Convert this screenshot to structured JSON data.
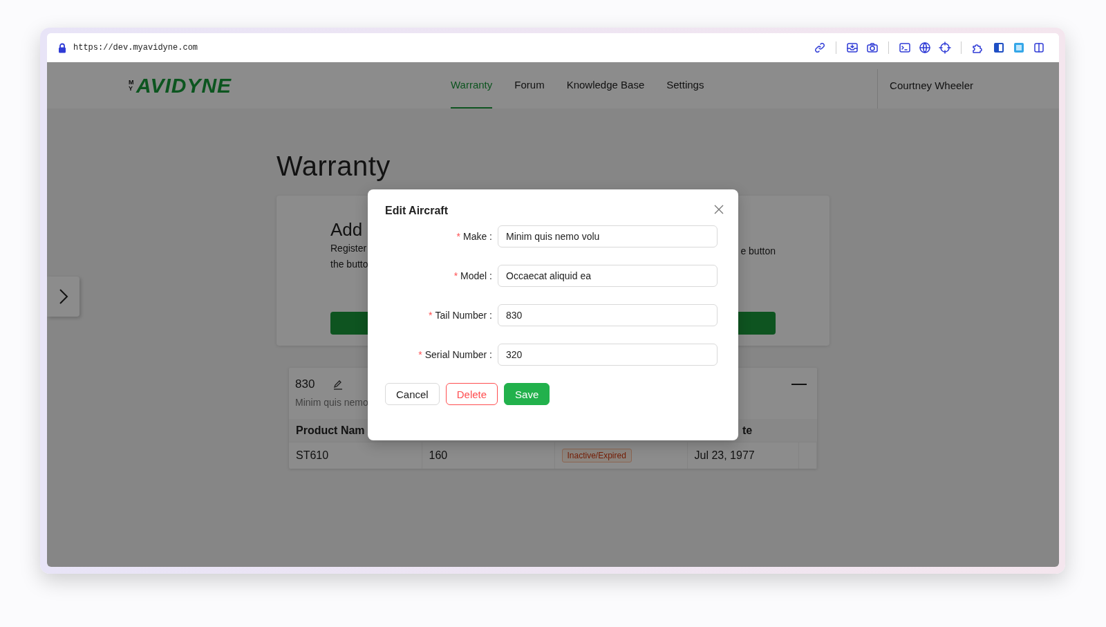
{
  "browser": {
    "url": "https://dev.myavidyne.com"
  },
  "header": {
    "logo": {
      "prefix": "MY",
      "name": "AVIDYNE"
    },
    "nav": [
      {
        "label": "Warranty",
        "selected": true
      },
      {
        "label": "Forum",
        "selected": false
      },
      {
        "label": "Knowledge Base",
        "selected": false
      },
      {
        "label": "Settings",
        "selected": false
      }
    ],
    "user": "Courtney Wheeler"
  },
  "page": {
    "title": "Warranty",
    "add_card": {
      "title": "Add",
      "left_lines": [
        "Register",
        "the butto"
      ],
      "right_text": "e button"
    },
    "aircraft": {
      "tail_number": "830",
      "subtitle": "Minim quis nemo",
      "table": {
        "column_1": "Product Nam",
        "column_4": "te",
        "rows": [
          {
            "product": "ST610",
            "column_2": "160",
            "status": "Inactive/Expired",
            "column_4": "Jul 23, 1977"
          }
        ]
      }
    }
  },
  "modal": {
    "title": "Edit Aircraft",
    "fields": [
      {
        "label": "Make :",
        "required_mark": "*",
        "value": "Minim quis nemo volu"
      },
      {
        "label": "Model :",
        "required_mark": "*",
        "value": "Occaecat aliquid ea"
      },
      {
        "label": "Tail Number :",
        "required_mark": "*",
        "value": "830"
      },
      {
        "label": "Serial Number :",
        "required_mark": "*",
        "value": "320"
      }
    ],
    "buttons": [
      {
        "label": "Cancel",
        "kind": "default"
      },
      {
        "label": "Delete",
        "kind": "danger"
      },
      {
        "label": "Save",
        "kind": "primary"
      }
    ]
  }
}
